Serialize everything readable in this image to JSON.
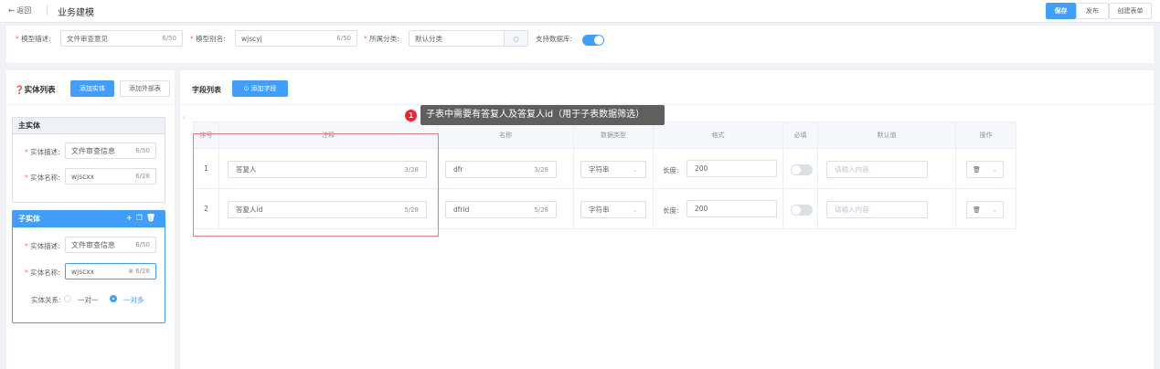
{
  "header": {
    "back": "返回",
    "title": "业务建模",
    "save": "保存",
    "publish": "发布",
    "create_form": "创建表单"
  },
  "model": {
    "desc_label": "模型描述:",
    "desc_value": "文件审查意见",
    "desc_count": "6/50",
    "alias_label": "模型别名:",
    "alias_value": "wjscyj",
    "alias_count": "6/50",
    "category_label": "所属分类:",
    "category_value": "默认分类",
    "db_label": "支持数据库:",
    "db_enabled": true
  },
  "entities": {
    "title": "实体列表",
    "add_entity": "添加实体",
    "add_external": "添加外部表",
    "main": {
      "header": "主实体",
      "desc_label": "实体描述:",
      "desc_value": "文件审查信息",
      "desc_count": "6/50",
      "name_label": "实体名称:",
      "name_value": "wjscxx",
      "name_count": "6/28"
    },
    "child": {
      "header": "子实体",
      "desc_label": "实体描述:",
      "desc_value": "文件审查信息",
      "desc_count": "6/50",
      "name_label": "实体名称:",
      "name_value": "wjscxx",
      "name_count": "6/28",
      "relation_label": "实体关系:",
      "one_to_one": "一对一",
      "one_to_many": "一对多",
      "selected": "一对多"
    }
  },
  "fields": {
    "title": "字段列表",
    "add_field": "添加字段",
    "columns": [
      "序号",
      "注释",
      "名称",
      "数据类型",
      "格式",
      "必填",
      "默认值",
      "操作"
    ],
    "rows": [
      {
        "index": "1",
        "comment": "答复人",
        "comment_count": "3/28",
        "name": "dfr",
        "name_count": "3/28",
        "type": "字符串",
        "length_label": "长度:",
        "length": "200",
        "required": false,
        "default_placeholder": "请输入内容"
      },
      {
        "index": "2",
        "comment": "答复人id",
        "comment_count": "5/28",
        "name": "dfrid",
        "name_count": "5/28",
        "type": "字符串",
        "length_label": "长度:",
        "length": "200",
        "required": false,
        "default_placeholder": "请输入内容"
      }
    ]
  },
  "annotation": {
    "badge": "1",
    "text": "子表中需要有答复人及答复人id（用于子表数据筛选）"
  },
  "colors": {
    "primary": "#409eff",
    "danger": "#f56c6c"
  }
}
